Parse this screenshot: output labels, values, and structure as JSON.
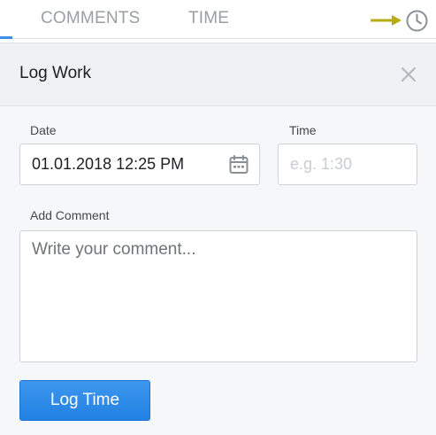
{
  "tabs": [
    {
      "label": "COMMENTS",
      "active": true
    },
    {
      "label": "TIME",
      "active": false
    }
  ],
  "icons": {
    "arrow": "arrow-right-icon",
    "clock": "clock-icon",
    "close": "close-icon",
    "calendar": "calendar-icon"
  },
  "colors": {
    "accent": "#2a87e8",
    "arrow": "#b4ad0c",
    "tab_text": "#9a9ea5",
    "dialog_bg": "#f6f7f9"
  },
  "dialog": {
    "title": "Log Work",
    "date_label": "Date",
    "date_value": "01.01.2018 12:25 PM",
    "time_label": "Time",
    "time_placeholder": "e.g. 1:30",
    "comment_label": "Add Comment",
    "comment_placeholder": "Write your comment...",
    "submit_label": "Log Time"
  }
}
